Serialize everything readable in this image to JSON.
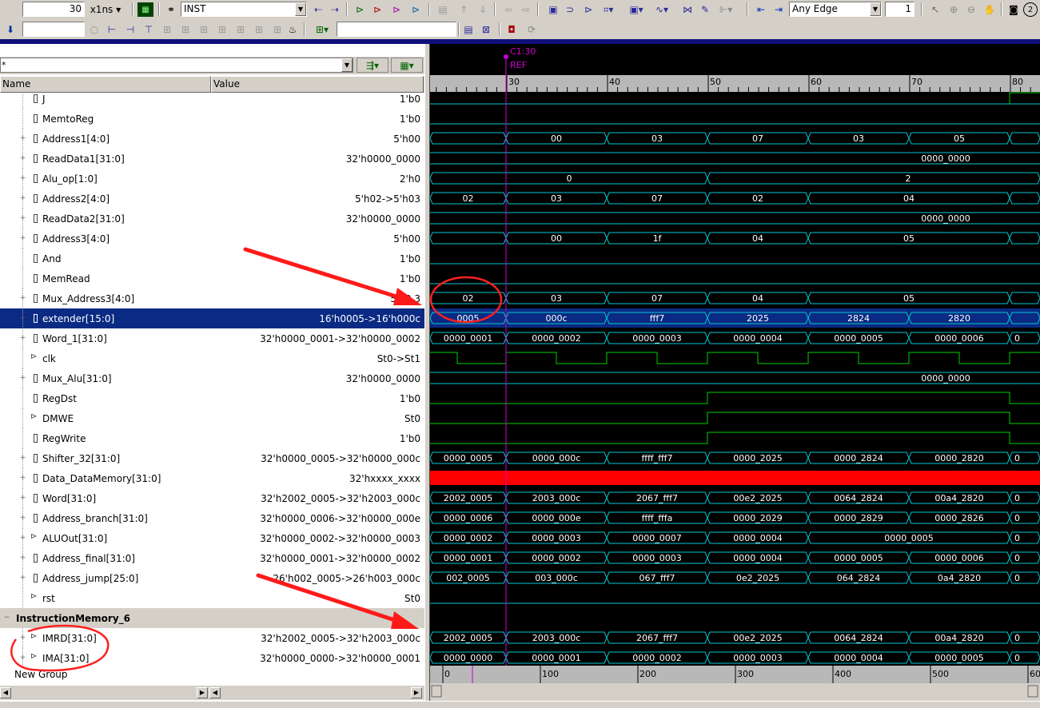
{
  "toolbar1": {
    "time_value": "30",
    "time_unit": "x1ns",
    "search_value": "INST",
    "edge_option": "Any Edge",
    "edge_count": "1",
    "help_number": "2"
  },
  "toolbar2": {
    "search_value": "",
    "dropdown_value": ""
  },
  "signal_list": {
    "filter_value": "*",
    "col_name": "Name",
    "col_value": "Value",
    "footer_group": "New Group",
    "rows": [
      {
        "name": "J",
        "value": "1'b0",
        "icon": "signal-icon",
        "expand": false
      },
      {
        "name": "MemtoReg",
        "value": "1'b0",
        "icon": "signal-icon",
        "expand": false
      },
      {
        "name": "Address1[4:0]",
        "value": "5'h00",
        "icon": "bus-icon",
        "expand": true
      },
      {
        "name": "ReadData1[31:0]",
        "value": "32'h0000_0000",
        "icon": "bus-icon",
        "expand": true
      },
      {
        "name": "Alu_op[1:0]",
        "value": "2'h0",
        "icon": "bus-icon",
        "expand": true
      },
      {
        "name": "Address2[4:0]",
        "value": "5'h02->5'h03",
        "icon": "bus-icon",
        "expand": true
      },
      {
        "name": "ReadData2[31:0]",
        "value": "32'h0000_0000",
        "icon": "bus-icon",
        "expand": true
      },
      {
        "name": "Address3[4:0]",
        "value": "5'h00",
        "icon": "bus-icon",
        "expand": true
      },
      {
        "name": "And",
        "value": "1'b0",
        "icon": "signal-icon",
        "expand": false
      },
      {
        "name": "MemRead",
        "value": "1'b0",
        "icon": "signal-icon",
        "expand": false
      },
      {
        "name": "Mux_Address3[4:0]",
        "value": "5'h0 3",
        "icon": "bus-icon",
        "expand": true
      },
      {
        "name": "extender[15:0]",
        "value": "16'h0005->16'h000c",
        "icon": "bus-icon",
        "expand": true,
        "selected": true
      },
      {
        "name": "Word_1[31:0]",
        "value": "32'h0000_0001->32'h0000_0002",
        "icon": "bus-icon",
        "expand": true
      },
      {
        "name": "clk",
        "value": "St0->St1",
        "icon": "port-icon",
        "expand": false
      },
      {
        "name": "Mux_Alu[31:0]",
        "value": "32'h0000_0000",
        "icon": "bus-icon",
        "expand": true
      },
      {
        "name": "RegDst",
        "value": "1'b0",
        "icon": "signal-icon",
        "expand": false
      },
      {
        "name": "DMWE",
        "value": "St0",
        "icon": "port-icon",
        "expand": false
      },
      {
        "name": "RegWrite",
        "value": "1'b0",
        "icon": "signal-icon",
        "expand": false
      },
      {
        "name": "Shifter_32[31:0]",
        "value": "32'h0000_0005->32'h0000_000c",
        "icon": "bus-icon",
        "expand": true
      },
      {
        "name": "Data_DataMemory[31:0]",
        "value": "32'hxxxx_xxxx",
        "icon": "bus-icon",
        "expand": true
      },
      {
        "name": "Word[31:0]",
        "value": "32'h2002_0005->32'h2003_000c",
        "icon": "bus-icon",
        "expand": true
      },
      {
        "name": "Address_branch[31:0]",
        "value": "32'h0000_0006->32'h0000_000e",
        "icon": "bus-icon",
        "expand": true
      },
      {
        "name": "ALUOut[31:0]",
        "value": "32'h0000_0002->32'h0000_0003",
        "icon": "port-icon",
        "expand": true
      },
      {
        "name": "Address_final[31:0]",
        "value": "32'h0000_0001->32'h0000_0002",
        "icon": "bus-icon",
        "expand": true
      },
      {
        "name": "Address_jump[25:0]",
        "value": "26'h002_0005->26'h003_000c",
        "icon": "bus-icon",
        "expand": true
      },
      {
        "name": "rst",
        "value": "St0",
        "icon": "port-icon",
        "expand": false
      },
      {
        "name": "InstructionMemory_6",
        "value": "",
        "icon": "",
        "expand": false,
        "group": true
      },
      {
        "name": "IMRD[31:0]",
        "value": "32'h2002_0005->32'h2003_000c",
        "icon": "port-icon",
        "expand": true
      },
      {
        "name": "IMA[31:0]",
        "value": "32'h0000_0000->32'h0000_0001",
        "icon": "port-icon",
        "expand": true
      }
    ]
  },
  "waveform": {
    "cursor_label": "C1:30",
    "ref_label": "REF",
    "time_ticks": [
      "30",
      "40",
      "50",
      "60",
      "70",
      "80"
    ],
    "bottom_ticks": [
      "0",
      "100",
      "200",
      "300",
      "400",
      "500",
      "60"
    ],
    "colors": {
      "wave": "#00c8d0",
      "clk": "#00d000",
      "x_state": "#ff0000",
      "cursor": "#d000d0",
      "selected": "#0a2a83"
    },
    "rows": [
      {
        "type": "bit",
        "segs": [
          [
            "0",
            0
          ]
        ]
      },
      {
        "type": "bit",
        "segs": [
          [
            "0",
            0
          ]
        ]
      },
      {
        "type": "bus",
        "labels": [
          "",
          "00",
          "03",
          "07",
          "03",
          "05",
          ""
        ]
      },
      {
        "type": "bus1",
        "label": "0000_0000"
      },
      {
        "type": "bus2",
        "labels": [
          "0",
          "2"
        ]
      },
      {
        "type": "bus",
        "labels": [
          "02",
          "03",
          "07",
          "02",
          "04",
          "",
          ""
        ]
      },
      {
        "type": "bus1",
        "label": "0000_0000"
      },
      {
        "type": "bus",
        "labels": [
          "",
          "00",
          "1f",
          "04",
          "05",
          "",
          ""
        ]
      },
      {
        "type": "bit"
      },
      {
        "type": "bit"
      },
      {
        "type": "bus",
        "labels": [
          "02",
          "03",
          "07",
          "04",
          "05",
          "",
          ""
        ]
      },
      {
        "type": "bus",
        "labels": [
          "0005",
          "000c",
          "fff7",
          "2025",
          "2824",
          "2820",
          ""
        ]
      },
      {
        "type": "bus",
        "labels": [
          "0000_0001",
          "0000_0002",
          "0000_0003",
          "0000_0004",
          "0000_0005",
          "0000_0006",
          "0"
        ]
      },
      {
        "type": "clk"
      },
      {
        "type": "bus1",
        "label": "0000_0000"
      },
      {
        "type": "step"
      },
      {
        "type": "step"
      },
      {
        "type": "step"
      },
      {
        "type": "bus",
        "labels": [
          "0000_0005",
          "0000_000c",
          "ffff_fff7",
          "0000_2025",
          "0000_2824",
          "0000_2820",
          "0"
        ]
      },
      {
        "type": "x"
      },
      {
        "type": "bus",
        "labels": [
          "2002_0005",
          "2003_000c",
          "2067_fff7",
          "00e2_2025",
          "0064_2824",
          "00a4_2820",
          "0"
        ]
      },
      {
        "type": "bus",
        "labels": [
          "0000_0006",
          "0000_000e",
          "ffff_fffa",
          "0000_2029",
          "0000_2829",
          "0000_2826",
          "0"
        ]
      },
      {
        "type": "bus",
        "labels": [
          "0000_0002",
          "0000_0003",
          "0000_0007",
          "0000_0004",
          "0000_0005",
          "",
          "0"
        ]
      },
      {
        "type": "bus",
        "labels": [
          "0000_0001",
          "0000_0002",
          "0000_0003",
          "0000_0004",
          "0000_0005",
          "0000_0006",
          "0"
        ]
      },
      {
        "type": "bus",
        "labels": [
          "002_0005",
          "003_000c",
          "067_fff7",
          "0e2_2025",
          "064_2824",
          "0a4_2820",
          "0"
        ]
      },
      {
        "type": "bit"
      },
      {
        "type": "none"
      },
      {
        "type": "bus",
        "labels": [
          "2002_0005",
          "2003_000c",
          "2067_fff7",
          "00e2_2025",
          "0064_2824",
          "00a4_2820",
          "0"
        ]
      },
      {
        "type": "bus",
        "labels": [
          "0000_0000",
          "0000_0001",
          "0000_0002",
          "0000_0003",
          "0000_0004",
          "0000_0005",
          "0"
        ]
      }
    ]
  }
}
